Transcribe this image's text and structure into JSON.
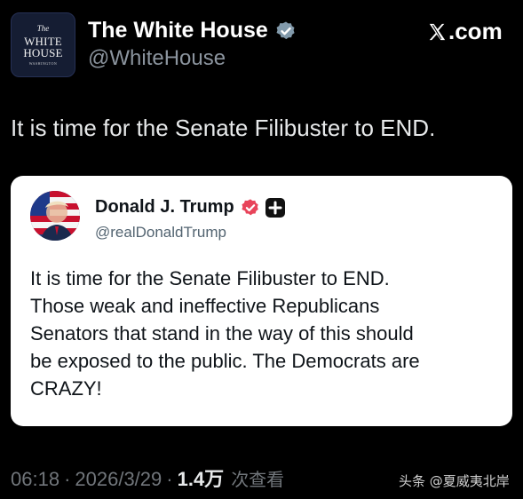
{
  "post": {
    "avatar": {
      "line1": "The",
      "line2": "WHITE",
      "line3": "HOUSE",
      "line4": "WASHINGTON"
    },
    "author_name": "The White House",
    "handle": "@WhiteHouse",
    "source_label": ".com",
    "text": "It is time for the Senate Filibuster to END."
  },
  "quote": {
    "author_name": "Donald J. Trump",
    "handle": "@realDonaldTrump",
    "lines": [
      "It is time for the Senate Filibuster to END.",
      "Those weak and ineffective Republicans",
      "Senators that stand in the way of this should",
      "be exposed to the public. The Democrats are",
      "CRAZY!"
    ]
  },
  "meta": {
    "time": "06:18",
    "separator": "·",
    "date": "2026/3/29",
    "views": "1.4万",
    "views_label": "次查看"
  },
  "watermark": "头条 @夏威夷北岸",
  "icons": {
    "verified_gov": "verified-gray-badge-icon",
    "verified_user": "verified-blue-badge-icon",
    "plus": "plus-badge-icon",
    "x_logo": "x-logo-icon"
  },
  "colors": {
    "background": "#000000",
    "card_background": "#ffffff",
    "verified_gov": "#829aab",
    "verified_user": "#1d9bf0",
    "muted_text": "#71767b"
  }
}
